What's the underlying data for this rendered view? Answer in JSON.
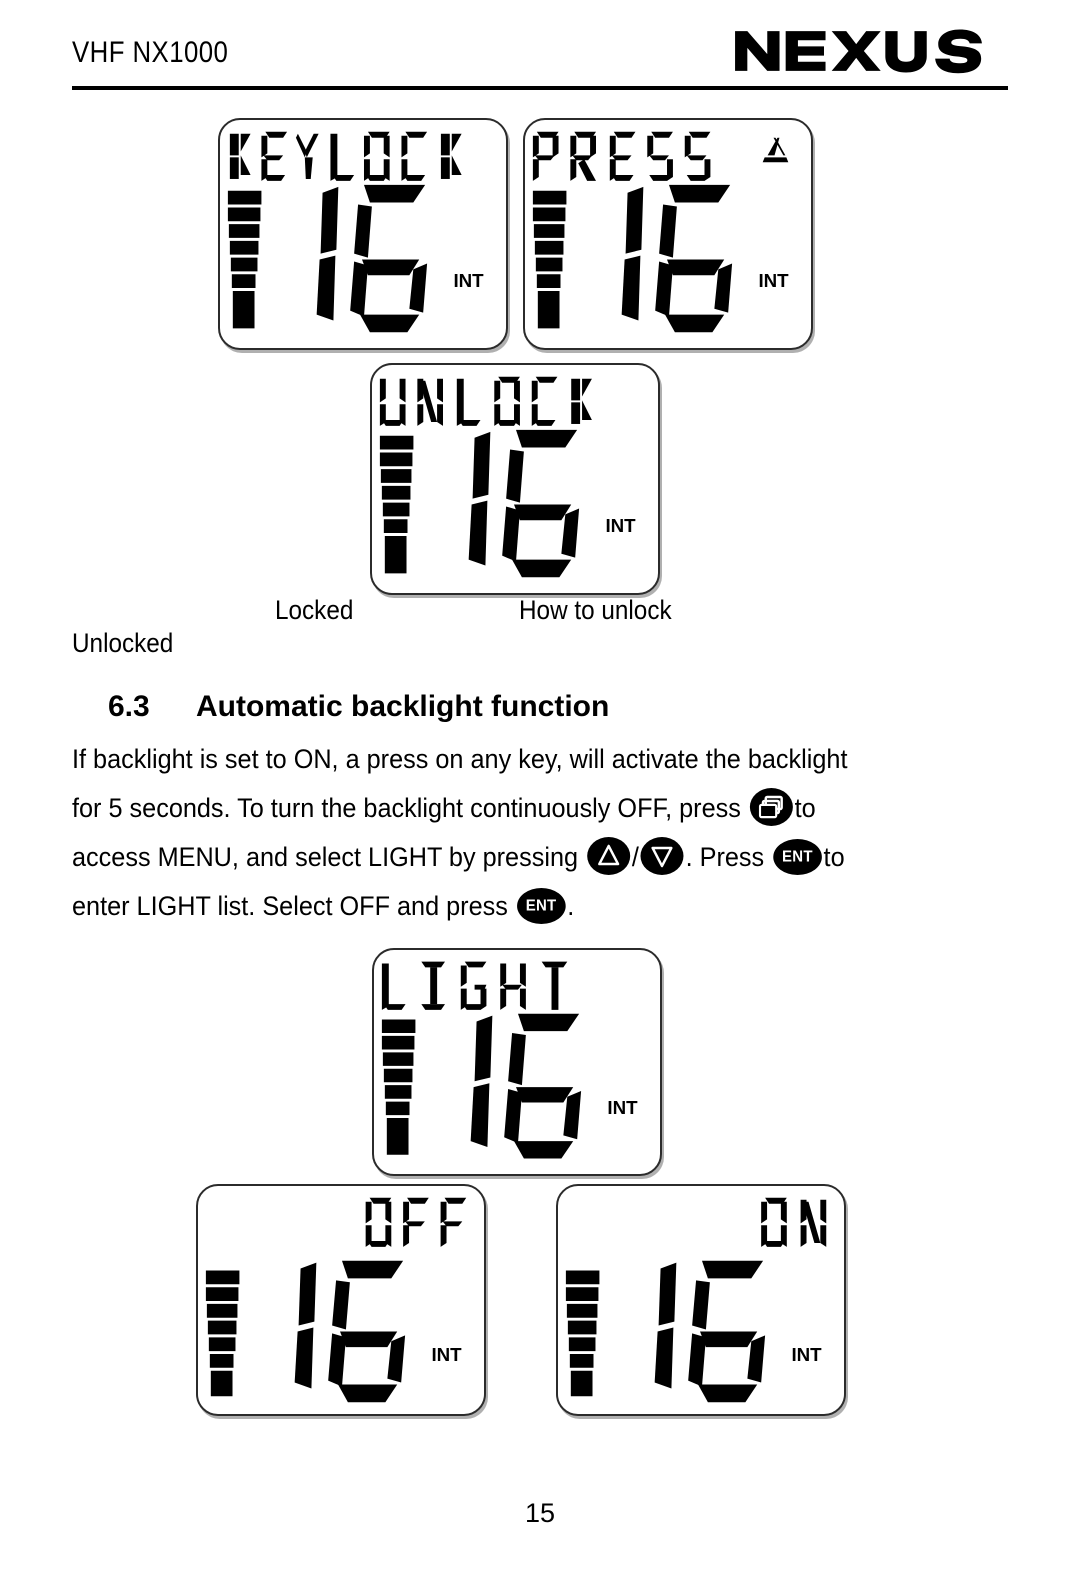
{
  "header": {
    "title": "VHF NX1000",
    "brand": "NEXUS"
  },
  "displays": [
    {
      "id": "keylock",
      "label_text": "KEYLOCK",
      "label_align": "left",
      "channel": "16",
      "unit": "INT",
      "bars": 7,
      "has_triangle": false
    },
    {
      "id": "press",
      "label_text": "PRESS",
      "label_align": "left",
      "channel": "16",
      "unit": "INT",
      "bars": 7,
      "has_triangle": true
    },
    {
      "id": "unlock",
      "label_text": "UNLOCK",
      "label_align": "left",
      "channel": "16",
      "unit": "INT",
      "bars": 7,
      "has_triangle": false
    },
    {
      "id": "light",
      "label_text": "LIGHT",
      "label_align": "left",
      "channel": "16",
      "unit": "INT",
      "bars": 7,
      "has_triangle": false
    },
    {
      "id": "off",
      "label_text": "OFF",
      "label_align": "right",
      "channel": "16",
      "unit": "INT",
      "bars": 7,
      "has_triangle": false
    },
    {
      "id": "on",
      "label_text": "ON",
      "label_align": "right",
      "channel": "16",
      "unit": "INT",
      "bars": 7,
      "has_triangle": false
    }
  ],
  "captions": {
    "locked": "Locked",
    "how_to_unlock": "How to unlock",
    "unlocked": "Unlocked"
  },
  "section": {
    "number": "6.3",
    "title": "Automatic backlight function"
  },
  "body": {
    "line1": "If backlight is set to ON, a press on any key, will activate the backlight",
    "line2a": "for 5 seconds. To turn the backlight continuously OFF, press",
    "line2b": "to",
    "line3a": "access MENU, and select LIGHT by pressing",
    "line3b": "/",
    "line3c": ". Press",
    "line3d": "to",
    "line4a": "enter LIGHT list. Select OFF and press",
    "line4b": "."
  },
  "keys": {
    "menu_icon": "cascading-windows-icon",
    "up_icon": "triangle-up-icon",
    "down_icon": "triangle-down-icon",
    "ent_label": "ENT"
  },
  "footer": {
    "page_number": "15"
  },
  "colors": {
    "ink": "#000000",
    "panel_border": "#2b2b2b",
    "background": "#ffffff"
  }
}
